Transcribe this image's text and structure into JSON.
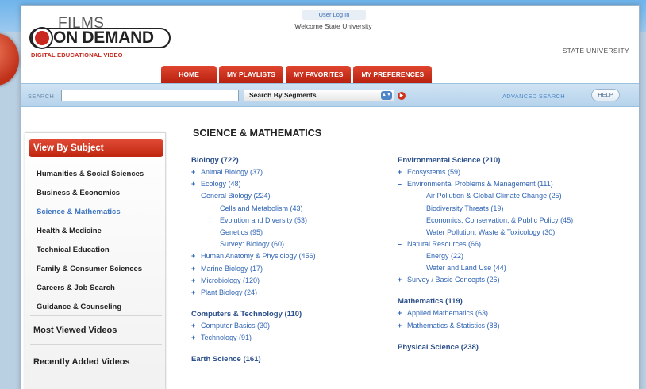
{
  "header": {
    "logo_line1": "FILMS",
    "logo_line2": "ON DEMAND",
    "logo_sub": "DIGITAL EDUCATIONAL VIDEO",
    "login": "User Log In",
    "welcome": "Welcome State University",
    "institution": "STATE UNIVERSITY"
  },
  "tabs": [
    "HOME",
    "MY PLAYLISTS",
    "MY FAVORITES",
    "MY PREFERENCES"
  ],
  "search": {
    "label": "SEARCH",
    "placeholder": "",
    "select_value": "Search By Segments",
    "advanced": "ADVANCED SEARCH",
    "help": "HELP"
  },
  "sidebar": {
    "heading": "View By Subject",
    "items": [
      "Humanities & Social Sciences",
      "Business & Economics",
      "Science & Mathematics",
      "Health & Medicine",
      "Technical Education",
      "Family & Consumer Sciences",
      "Careers & Job Search",
      "Guidance & Counseling"
    ],
    "active_index": 2,
    "most_viewed": "Most Viewed Videos",
    "recently_added": "Recently Added Videos"
  },
  "main": {
    "title": "SCIENCE & MATHEMATICS",
    "left_col": {
      "biology": {
        "cat": "Biology (722)",
        "rows": [
          {
            "sym": "+",
            "text": "Animal Biology (37)"
          },
          {
            "sym": "+",
            "text": "Ecology (48)"
          },
          {
            "sym": "–",
            "text": "General Biology (224)"
          },
          {
            "sub": true,
            "text": "Cells and Metabolism (43)"
          },
          {
            "sub": true,
            "text": "Evolution and Diversity (53)"
          },
          {
            "sub": true,
            "text": "Genetics (95)"
          },
          {
            "sub": true,
            "text": "Survey: Biology (60)"
          },
          {
            "sym": "+",
            "text": "Human Anatomy & Physiology (456)"
          },
          {
            "sym": "+",
            "text": "Marine Biology (17)"
          },
          {
            "sym": "+",
            "text": "Microbiology (120)"
          },
          {
            "sym": "+",
            "text": "Plant Biology (24)"
          }
        ]
      },
      "computers": {
        "cat": "Computers & Technology (110)",
        "rows": [
          {
            "sym": "+",
            "text": "Computer Basics (30)"
          },
          {
            "sym": "+",
            "text": "Technology (91)"
          }
        ]
      },
      "earth": {
        "cat": "Earth Science (161)"
      }
    },
    "right_col": {
      "environmental": {
        "cat": "Environmental Science (210)",
        "rows": [
          {
            "sym": "+",
            "text": "Ecosystems (59)"
          },
          {
            "sym": "–",
            "text": "Environmental Problems & Management (111)"
          },
          {
            "sub": true,
            "text": "Air Pollution & Global Climate Change (25)"
          },
          {
            "sub": true,
            "text": "Biodiversity Threats (19)"
          },
          {
            "sub": true,
            "wrap": true,
            "text": "Economics, Conservation, & Public Policy (45)"
          },
          {
            "sub": true,
            "text": "Water Pollution, Waste & Toxicology (30)"
          },
          {
            "sym": "–",
            "text": "Natural Resources (66)"
          },
          {
            "sub": true,
            "text": "Energy (22)"
          },
          {
            "sub": true,
            "text": "Water and Land Use (44)"
          },
          {
            "sym": "+",
            "text": "Survey / Basic Concepts (26)"
          }
        ]
      },
      "math": {
        "cat": "Mathematics (119)",
        "rows": [
          {
            "sym": "+",
            "text": "Applied Mathematics (63)"
          },
          {
            "sym": "+",
            "text": "Mathematics & Statistics (88)"
          }
        ]
      },
      "physical": {
        "cat": "Physical Science (238)"
      }
    }
  }
}
